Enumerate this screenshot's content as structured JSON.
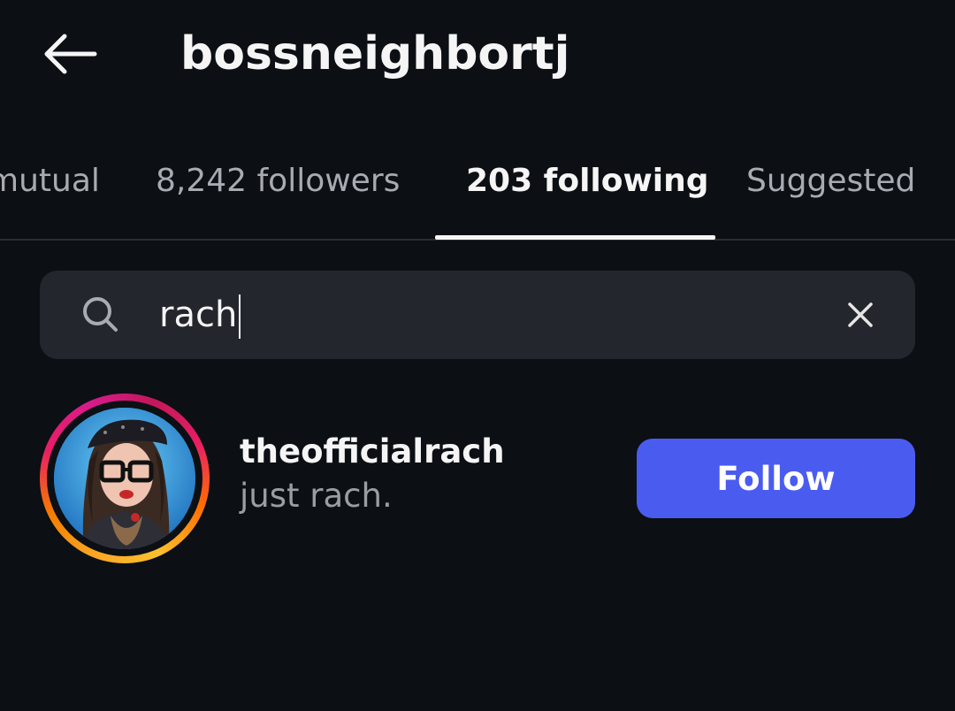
{
  "header": {
    "title": "bossneighbortj",
    "back_icon": "back-arrow-icon"
  },
  "tabs": [
    {
      "label": "mutual",
      "active": false
    },
    {
      "label": "8,242 followers",
      "active": false
    },
    {
      "label": "203 following",
      "active": true
    },
    {
      "label": "Suggested",
      "active": false
    }
  ],
  "search": {
    "value": "rach",
    "icon": "search-icon",
    "clear_icon": "close-icon"
  },
  "results": [
    {
      "username": "theofficialrach",
      "bio": "just rach.",
      "action_label": "Follow",
      "has_story_ring": true
    }
  ],
  "colors": {
    "background": "#0c0f14",
    "search_bg": "#23262c",
    "accent": "#4a5cf0",
    "muted_text": "#9a9da3"
  }
}
